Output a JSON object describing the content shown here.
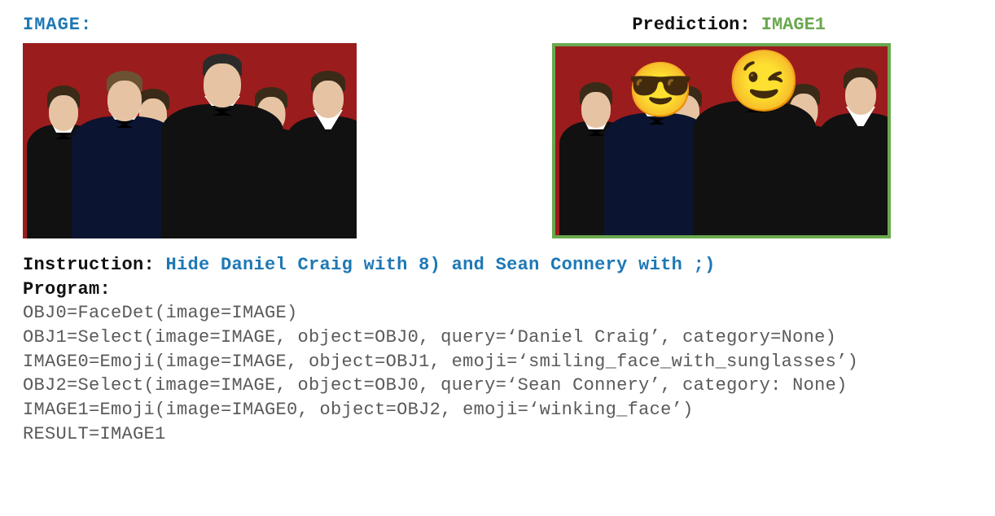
{
  "header": {
    "image_label": "IMAGE:",
    "prediction_label": "Prediction: ",
    "prediction_value": "IMAGE1"
  },
  "instruction": {
    "label": "Instruction: ",
    "text": "Hide Daniel Craig with 8) and Sean Connery with ;)"
  },
  "program": {
    "label": "Program:",
    "lines": [
      "OBJ0=FaceDet(image=IMAGE)",
      "OBJ1=Select(image=IMAGE, object=OBJ0, query=‘Daniel Craig’, category=None)",
      "IMAGE0=Emoji(image=IMAGE, object=OBJ1, emoji=‘smiling_face_with_sunglasses’)",
      "OBJ2=Select(image=IMAGE, object=OBJ0, query=‘Sean Connery’, category: None)",
      "IMAGE1=Emoji(image=IMAGE0, object=OBJ2, emoji=‘winking_face’)",
      "RESULT=IMAGE1"
    ]
  },
  "emojis": {
    "sunglasses": "😎",
    "wink": "😉"
  }
}
